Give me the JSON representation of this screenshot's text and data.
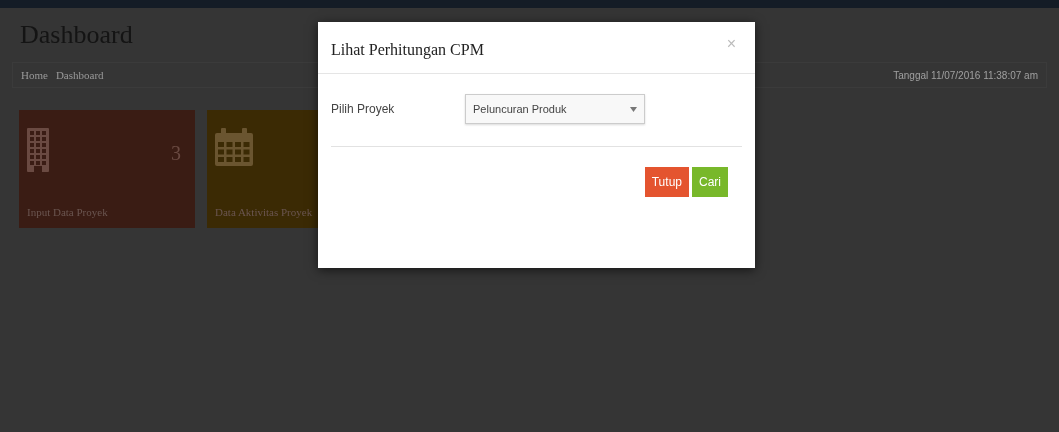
{
  "page": {
    "title": "Dashboard",
    "breadcrumb": [
      {
        "label": "Home"
      },
      {
        "label": "Dashboard"
      }
    ],
    "date": "Tanggal 11/07/2016 11:38:07 am"
  },
  "tiles": [
    {
      "label": "Input Data Proyek",
      "count": "3",
      "kind": "building",
      "color": "#3a1c14"
    },
    {
      "label": "Data Aktivitas Proyek",
      "kind": "calendar",
      "color": "#3b2a04"
    }
  ],
  "modal": {
    "title": "Lihat Perhitungan CPM",
    "close": "×",
    "field_label": "Pilih Proyek",
    "select_value": "Peluncuran Produk",
    "buttons": [
      {
        "label": "Tutup",
        "kind": "danger"
      },
      {
        "label": "Cari",
        "kind": "success"
      }
    ]
  }
}
